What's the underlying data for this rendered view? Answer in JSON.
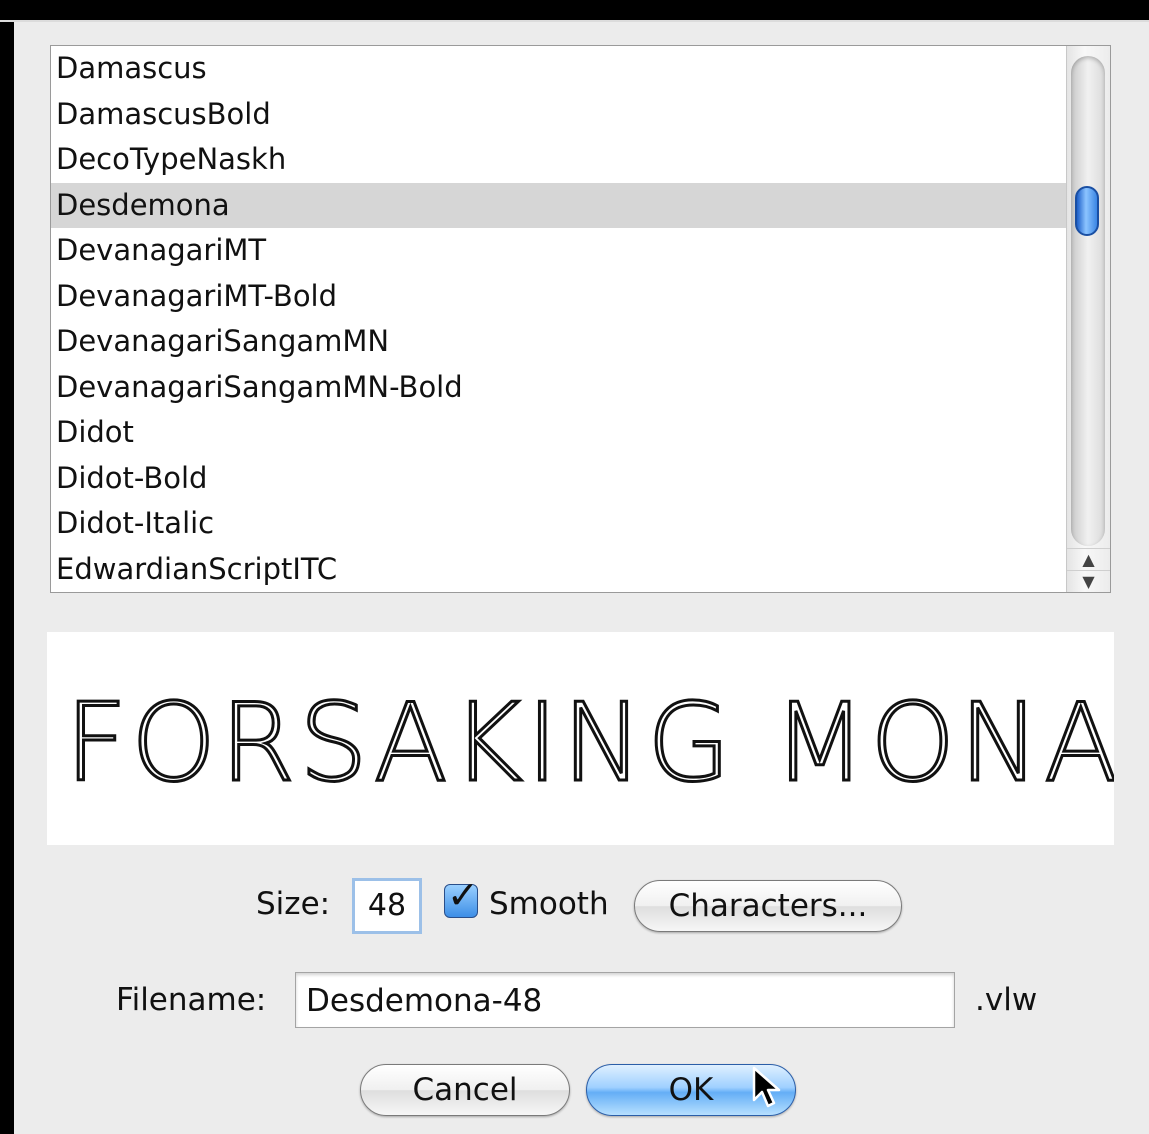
{
  "font_list": {
    "items": [
      "Damascus",
      "DamascusBold",
      "DecoTypeNaskh",
      "Desdemona",
      "DevanagariMT",
      "DevanagariMT-Bold",
      "DevanagariSangamMN",
      "DevanagariSangamMN-Bold",
      "Didot",
      "Didot-Bold",
      "Didot-Italic",
      "EdwardianScriptITC"
    ],
    "selected": "Desdemona"
  },
  "preview": {
    "text": "FORSAKING MONASTI"
  },
  "size": {
    "label": "Size:",
    "value": "48"
  },
  "smooth": {
    "label": "Smooth",
    "checked": true
  },
  "characters_button": {
    "label": "Characters..."
  },
  "filename": {
    "label": "Filename:",
    "value": "Desdemona-48",
    "extension": ".vlw"
  },
  "buttons": {
    "cancel": "Cancel",
    "ok": "OK"
  },
  "icons": {
    "scroll_up": "up-arrow-icon",
    "scroll_down": "down-arrow-icon",
    "checkmark": "checkmark-icon",
    "cursor": "mouse-pointer-icon"
  },
  "colors": {
    "accent": "#3b86e4",
    "selection": "#d6d6d6",
    "panel": "#ececec"
  }
}
